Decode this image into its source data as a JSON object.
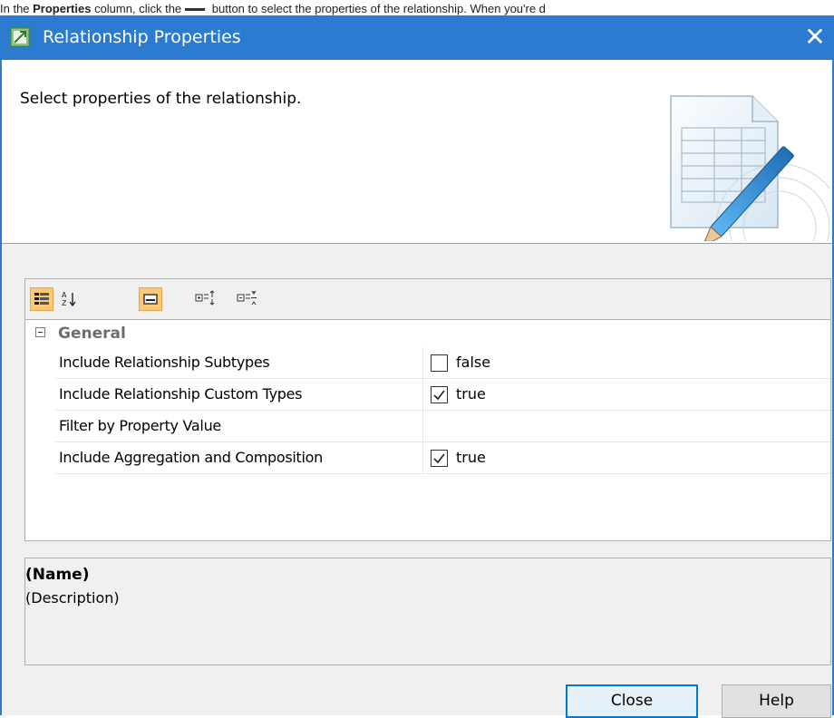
{
  "doc_strip": {
    "prefix": "In the ",
    "bold": "Properties",
    "middle": " column, click the",
    "suffix": " button to select the properties of the relationship. When you're d"
  },
  "window": {
    "title": "Relationship Properties",
    "close_glyph": "✕",
    "instruction": "Select properties of the relationship."
  },
  "toolbar": {
    "buttons": [
      {
        "name": "categorized-view-icon",
        "active": true
      },
      {
        "name": "sort-alphabetically-icon",
        "active": false
      },
      {
        "name": "show-description-icon",
        "active": true
      },
      {
        "name": "expand-all-icon",
        "active": false
      },
      {
        "name": "collapse-all-icon",
        "active": false
      }
    ]
  },
  "properties": {
    "group": "General",
    "rows": [
      {
        "name": "Include Relationship Subtypes",
        "value": "false",
        "checkbox": true,
        "checked": false
      },
      {
        "name": "Include Relationship Custom Types",
        "value": "true",
        "checkbox": true,
        "checked": true
      },
      {
        "name": "Filter by Property Value",
        "value": "",
        "checkbox": false,
        "checked": false
      },
      {
        "name": "Include Aggregation and Composition",
        "value": "true",
        "checkbox": true,
        "checked": true
      }
    ]
  },
  "description": {
    "name": "(Name)",
    "text": "(Description)"
  },
  "buttons": {
    "close": "Close",
    "help": "Help"
  },
  "colors": {
    "titlebar": "#2b7bd1",
    "toolbar_active": "#ffc874",
    "group_label": "#6d6d6d",
    "primary_button_border": "#0078d7"
  }
}
